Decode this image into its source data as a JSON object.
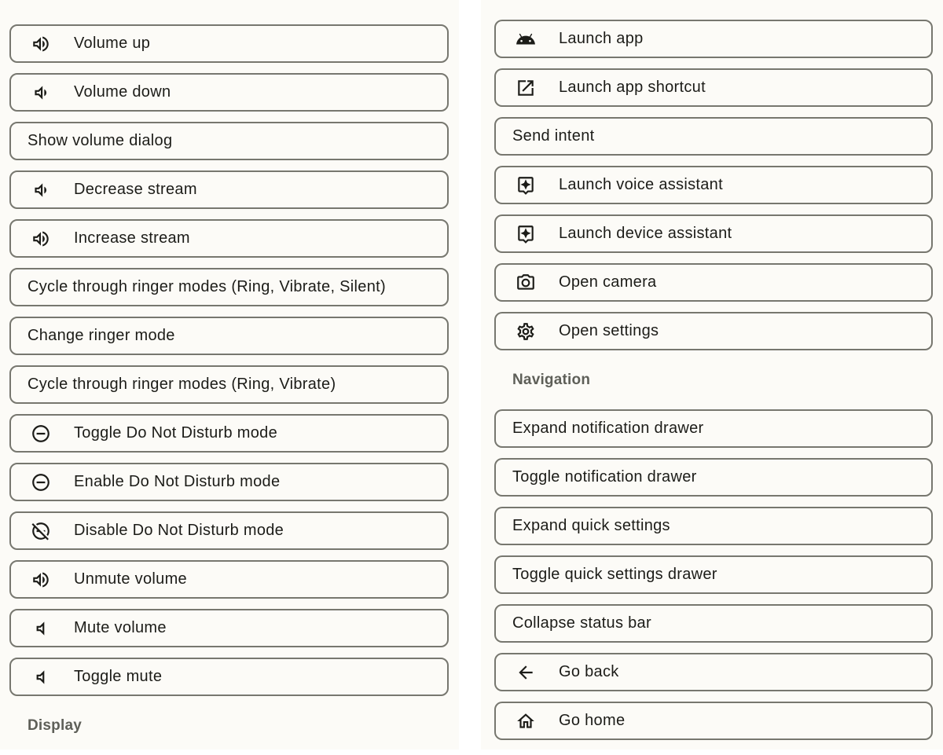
{
  "left": {
    "items": [
      {
        "label": "Volume up",
        "icon": "volume-up-icon"
      },
      {
        "label": "Volume down",
        "icon": "volume-down-icon"
      },
      {
        "label": "Show volume dialog",
        "icon": null
      },
      {
        "label": "Decrease stream",
        "icon": "volume-down-icon"
      },
      {
        "label": "Increase stream",
        "icon": "volume-up-icon"
      },
      {
        "label": "Cycle through ringer modes (Ring, Vibrate, Silent)",
        "icon": null
      },
      {
        "label": "Change ringer mode",
        "icon": null
      },
      {
        "label": "Cycle through ringer modes (Ring, Vibrate)",
        "icon": null
      },
      {
        "label": "Toggle Do Not Disturb mode",
        "icon": "do-not-disturb-icon"
      },
      {
        "label": "Enable Do Not Disturb mode",
        "icon": "do-not-disturb-icon"
      },
      {
        "label": "Disable Do Not Disturb mode",
        "icon": "do-not-disturb-off-icon"
      },
      {
        "label": "Unmute volume",
        "icon": "volume-up-icon"
      },
      {
        "label": "Mute volume",
        "icon": "volume-mute-icon"
      },
      {
        "label": "Toggle mute",
        "icon": "volume-mute-icon"
      }
    ],
    "section_header": "Display"
  },
  "right": {
    "items_top": [
      {
        "label": "Launch app",
        "icon": "android-icon"
      },
      {
        "label": "Launch app shortcut",
        "icon": "open-in-new-icon"
      },
      {
        "label": "Send intent",
        "icon": null
      },
      {
        "label": "Launch voice assistant",
        "icon": "assistant-icon"
      },
      {
        "label": "Launch device assistant",
        "icon": "assistant-icon"
      },
      {
        "label": "Open camera",
        "icon": "camera-icon"
      },
      {
        "label": "Open settings",
        "icon": "settings-gear-icon"
      }
    ],
    "section_header": "Navigation",
    "items_nav": [
      {
        "label": "Expand notification drawer",
        "icon": null
      },
      {
        "label": "Toggle notification drawer",
        "icon": null
      },
      {
        "label": "Expand quick settings",
        "icon": null
      },
      {
        "label": "Toggle quick settings drawer",
        "icon": null
      },
      {
        "label": "Collapse status bar",
        "icon": null
      },
      {
        "label": "Go back",
        "icon": "arrow-back-icon"
      },
      {
        "label": "Go home",
        "icon": "home-icon"
      }
    ]
  }
}
